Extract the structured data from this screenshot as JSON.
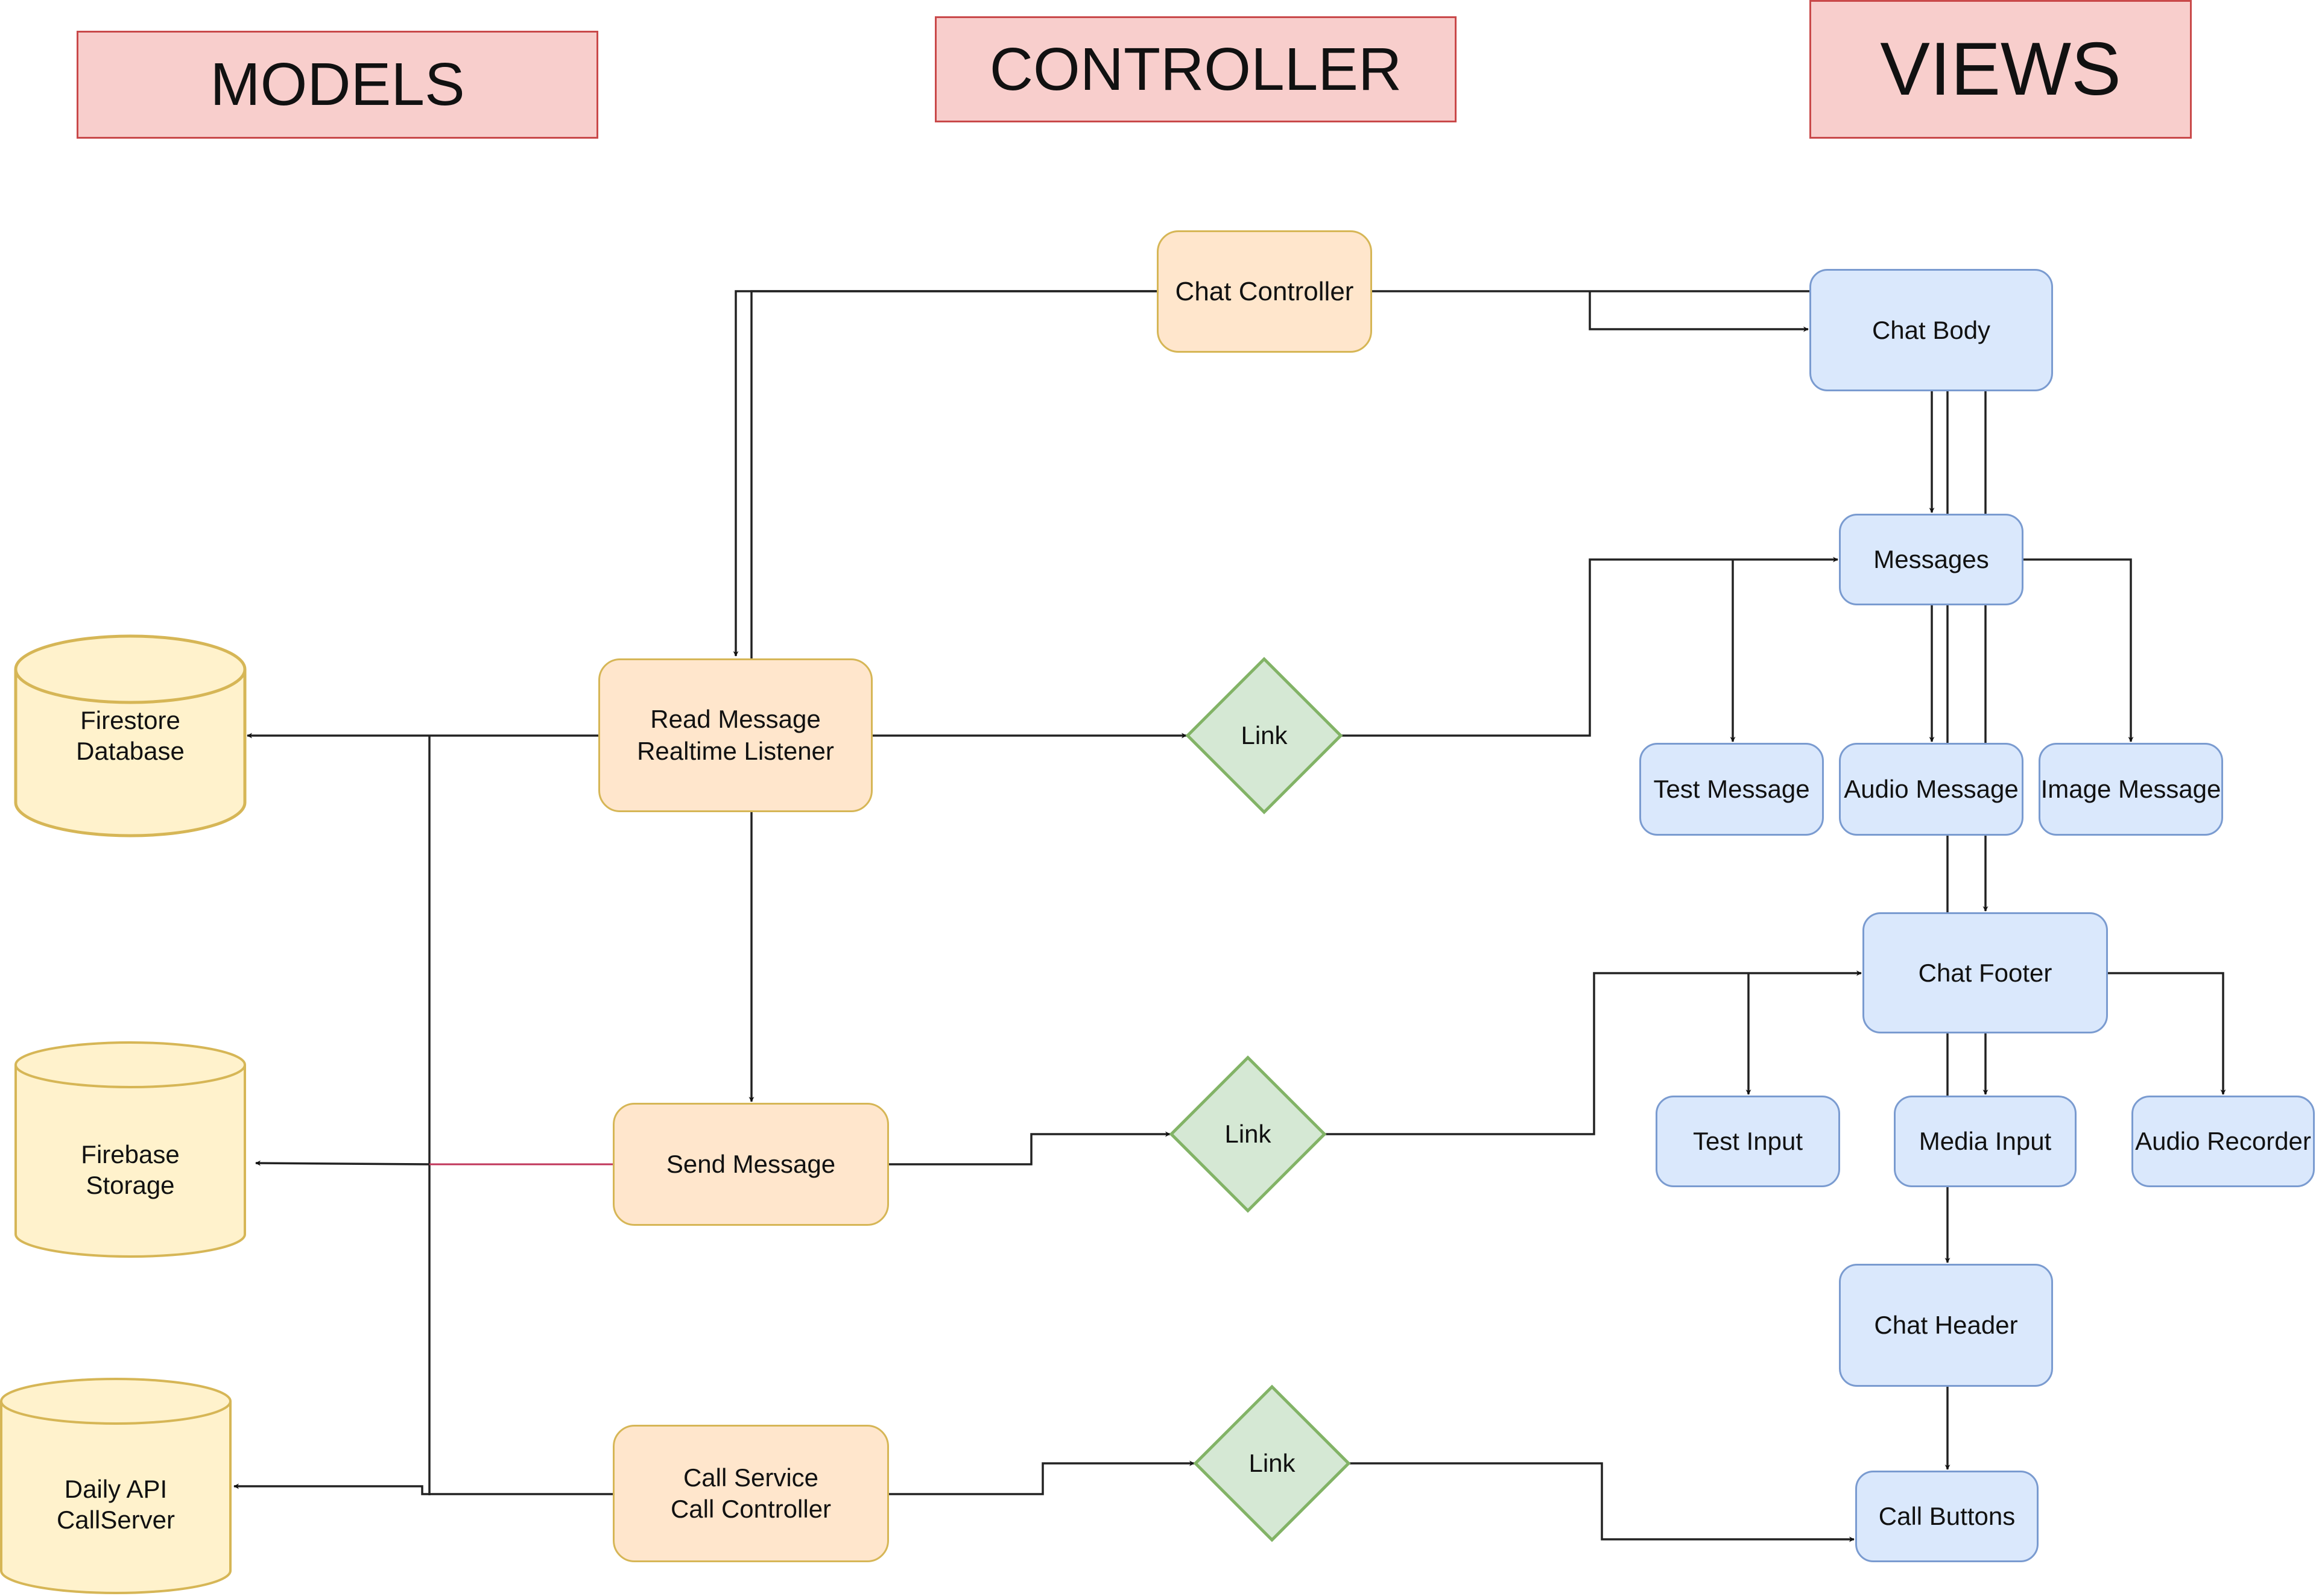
{
  "headers": {
    "models": "MODELS",
    "controller": "CONTROLLER",
    "views": "VIEWS"
  },
  "models": {
    "firestore": "Firestore\nDatabase",
    "storage": "Firebase\nStorage",
    "daily": "Daily API\nCallServer"
  },
  "controllers": {
    "chat_controller": "Chat Controller",
    "read_message": "Read Message\nRealtime Listener",
    "send_message": "Send Message",
    "call_service": "Call Service\nCall Controller"
  },
  "links": {
    "link1": "Link",
    "link2": "Link",
    "link3": "Link"
  },
  "views": {
    "chat_body": "Chat Body",
    "messages": "Messages",
    "test_message": "Test Message",
    "audio_message": "Audio Message",
    "image_message": "Image Message",
    "chat_footer": "Chat Footer",
    "test_input": "Test Input",
    "media_input": "Media Input",
    "audio_recorder": "Audio Recorder",
    "chat_header": "Chat Header",
    "call_buttons": "Call Buttons"
  },
  "colors": {
    "header_fill": "#f8cecc",
    "controller_fill": "#ffe6cc",
    "view_fill": "#dae8fc",
    "link_fill": "#d5e8d4",
    "model_fill": "#fff2cc",
    "highlight_edge": "#c0365a"
  }
}
